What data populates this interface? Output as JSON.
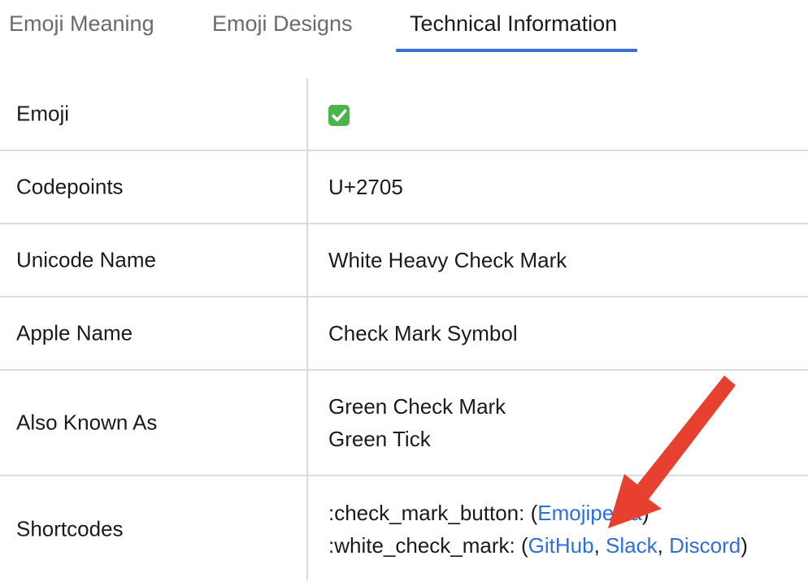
{
  "tabs": [
    {
      "label": "Emoji Meaning"
    },
    {
      "label": "Emoji Designs"
    },
    {
      "label": "Technical Information"
    }
  ],
  "rows": {
    "emoji": {
      "label": "Emoji",
      "value": "white-heavy-check-mark-icon"
    },
    "codepoints": {
      "label": "Codepoints",
      "value": "U+2705"
    },
    "unicode_name": {
      "label": "Unicode Name",
      "value": "White Heavy Check Mark"
    },
    "apple_name": {
      "label": "Apple Name",
      "value": "Check Mark Symbol"
    },
    "also_known_as": {
      "label": "Also Known As",
      "values": [
        "Green Check Mark",
        "Green Tick"
      ]
    },
    "shortcodes": {
      "label": "Shortcodes",
      "line1": {
        "code": ":check_mark_button: (",
        "link": "Emojipedia",
        "close": ")"
      },
      "line2": {
        "code": ":white_check_mark: (",
        "links": [
          "GitHub",
          "Slack",
          "Discord"
        ],
        "sep": ", ",
        "close": ")"
      }
    }
  },
  "colors": {
    "accent": "#3b6fd6",
    "link": "#2f6fdc",
    "arrow": "#e8402e",
    "check": "#48b44a"
  }
}
